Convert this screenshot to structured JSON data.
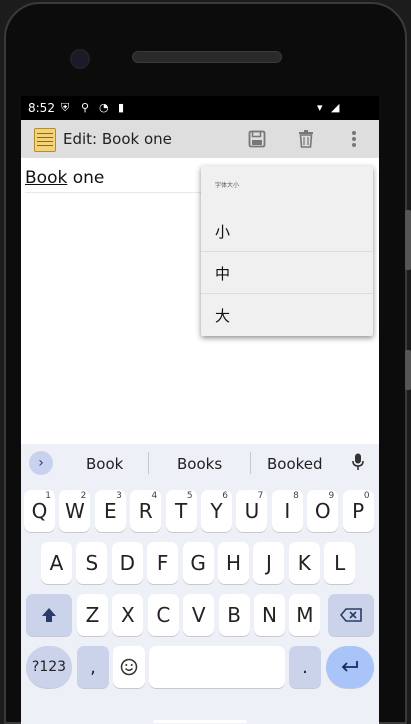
{
  "status": {
    "time": "8:52"
  },
  "appbar": {
    "title": "Edit: Book one",
    "save_icon": "save-icon",
    "delete_icon": "delete-icon",
    "menu_icon": "more-vert-icon"
  },
  "editor": {
    "underlined_word": "Book",
    "rest_text": " one"
  },
  "popup": {
    "header": "字体大小",
    "options": [
      "小",
      "中",
      "大"
    ]
  },
  "keyboard": {
    "suggestions": [
      "Book",
      "Books",
      "Booked"
    ],
    "row1": [
      {
        "k": "Q",
        "h": "1"
      },
      {
        "k": "W",
        "h": "2"
      },
      {
        "k": "E",
        "h": "3"
      },
      {
        "k": "R",
        "h": "4"
      },
      {
        "k": "T",
        "h": "5"
      },
      {
        "k": "Y",
        "h": "6"
      },
      {
        "k": "U",
        "h": "7"
      },
      {
        "k": "I",
        "h": "8"
      },
      {
        "k": "O",
        "h": "9"
      },
      {
        "k": "P",
        "h": "0"
      }
    ],
    "row2": [
      "A",
      "S",
      "D",
      "F",
      "G",
      "H",
      "J",
      "K",
      "L"
    ],
    "row3": [
      "Z",
      "X",
      "C",
      "V",
      "B",
      "N",
      "M"
    ],
    "symbols_label": "?123",
    "comma_label": ",",
    "period_label": "."
  },
  "colors": {
    "appbar": "#dedede",
    "keyboard_bg": "#eef0f8",
    "fn_key": "#cbd3ea",
    "enter_key": "#a8c4f8"
  }
}
